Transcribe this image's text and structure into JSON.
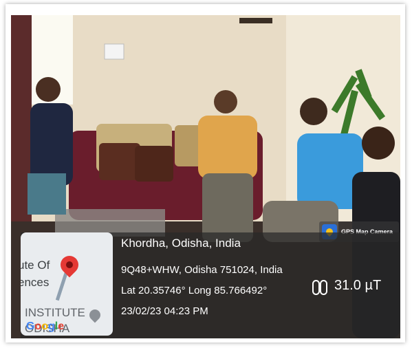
{
  "gps_badge": {
    "label": "GPS Map Camera",
    "icon": "gps-map-camera-icon"
  },
  "map_thumbnail": {
    "fragments": [
      "ute Of",
      "ences",
      "INSTITUTE",
      "ODISHA"
    ],
    "logo": "Google",
    "icons": [
      "map-pin-red-icon",
      "map-pin-grey-icon"
    ]
  },
  "location": {
    "title": "Khordha, Odisha, India",
    "plus_code": "9Q48+WHW, Odisha 751024, India",
    "coords": "Lat 20.35746° Long 85.766492°",
    "datetime": "23/02/23 04:23 PM"
  },
  "sensor": {
    "value": "31.0 µT",
    "icon": "magnetic-field-icon"
  },
  "colors": {
    "overlay": "#2a2a2a",
    "pin_red": "#e53935",
    "wall": "#ece2cf"
  }
}
